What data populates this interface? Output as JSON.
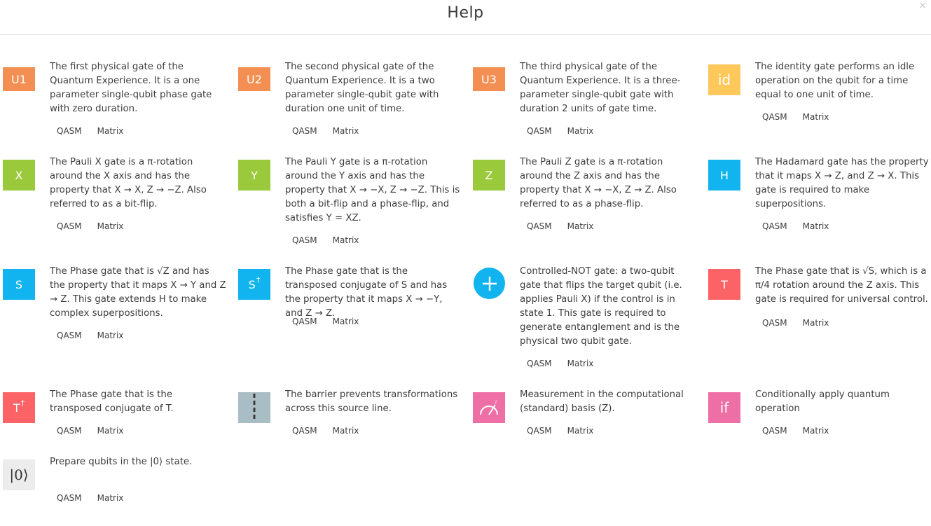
{
  "header": {
    "title": "Help",
    "close": "×"
  },
  "colors": {
    "u": "#f48f53",
    "id": "#ffc85b",
    "pauli": "#9ac93b",
    "blue": "#11b4ee",
    "red": "#fb6367",
    "pink": "#ee6fa5",
    "barrier": "#a9bdc4",
    "zero": "#ececec"
  },
  "link_labels": {
    "qasm": "QASM",
    "matrix": "Matrix"
  },
  "gates": [
    {
      "symbol": "U1",
      "color_key": "u",
      "desc": "The first physical gate of the Quantum Experience. It is a one parameter single-qubit phase gate with zero duration."
    },
    {
      "symbol": "U2",
      "color_key": "u",
      "desc": "The second physical gate of the Quantum Experience. It is a two parameter single-qubit gate with duration one unit of time."
    },
    {
      "symbol": "U3",
      "color_key": "u",
      "desc": "The third physical gate of the Quantum Experience. It is a three-parameter single-qubit gate with duration 2 units of gate time."
    },
    {
      "symbol": "id",
      "color_key": "id",
      "desc": "The identity gate performs an idle operation on the qubit for a time equal to one unit of time."
    },
    {
      "symbol": "X",
      "color_key": "pauli",
      "desc": "The Pauli X gate is a π-rotation around the X axis and has the property that X → X, Z → −Z. Also referred to as a bit-flip."
    },
    {
      "symbol": "Y",
      "color_key": "pauli",
      "desc": "The Pauli Y gate is a π-rotation around the Y axis and has the property that X → −X, Z → −Z. This is both a bit-flip and a phase-flip, and satisfies Y = XZ."
    },
    {
      "symbol": "Z",
      "color_key": "pauli",
      "desc": "The Pauli Z gate is a π-rotation around the Z axis and has the property that X → −X, Z → Z. Also referred to as a phase-flip."
    },
    {
      "symbol": "H",
      "color_key": "blue",
      "desc": "The Hadamard gate has the property that it maps X → Z, and Z → X. This gate is required to make superpositions."
    },
    {
      "symbol": "S",
      "color_key": "blue",
      "desc": "The Phase gate that is √Z and has the property that it maps X → Y and Z → Z. This gate extends H to make complex superpositions."
    },
    {
      "symbol": "S",
      "sup": "†",
      "color_key": "blue",
      "desc": "The Phase gate that is the transposed conjugate of S and has the property that it maps X → −Y, and Z → Z."
    },
    {
      "symbol": "+",
      "color_key": "blue",
      "icon": "cnot-plus-icon",
      "desc": "Controlled-NOT gate: a two-qubit gate that flips the target qubit (i.e. applies Pauli X) if the control is in state 1. This gate is required to generate entanglement and is the physical two qubit gate."
    },
    {
      "symbol": "T",
      "color_key": "red",
      "desc": "The Phase gate that is √S, which is a π/4 rotation around the Z axis. This gate is required for universal control."
    },
    {
      "symbol": "T",
      "sup": "†",
      "color_key": "red",
      "desc": "The Phase gate that is the transposed conjugate of T."
    },
    {
      "symbol": "",
      "color_key": "barrier",
      "icon": "barrier-icon",
      "desc": "The barrier prevents transformations across this source line."
    },
    {
      "symbol": "",
      "color_key": "pink",
      "icon": "meter-icon",
      "desc": "Measurement in the computational (standard) basis (Z)."
    },
    {
      "symbol": "if",
      "color_key": "pink",
      "desc": "Conditionally apply quantum operation"
    },
    {
      "symbol": "|0⟩",
      "color_key": "zero",
      "desc": "Prepare qubits in the |0⟩ state."
    }
  ]
}
